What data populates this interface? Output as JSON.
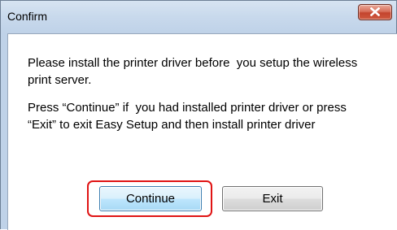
{
  "dialog": {
    "title": "Confirm",
    "message_line1": "Please install the printer driver before  you setup the wireless print server.",
    "message_line2": "Press “Continue” if  you had installed printer driver or press “Exit” to exit Easy Setup and then install printer driver",
    "close_icon": "close-icon",
    "buttons": {
      "continue_label": "Continue",
      "exit_label": "Exit"
    }
  },
  "colors": {
    "highlight": "#e01414",
    "close_button": "#c3442e",
    "title_bar": "#c8d9ec"
  }
}
